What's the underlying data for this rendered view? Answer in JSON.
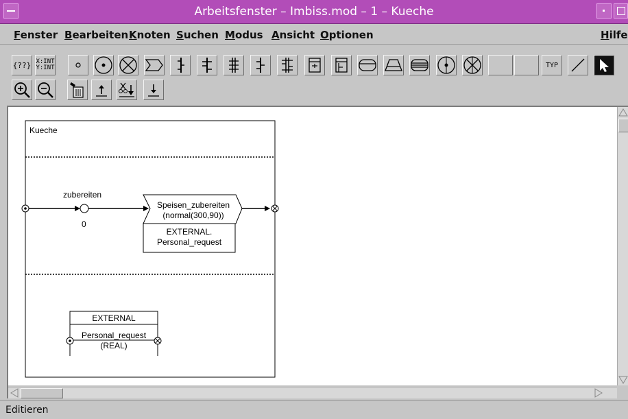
{
  "window": {
    "title": "Arbeitsfenster – Imbiss.mod – 1 – Kueche"
  },
  "menubar": {
    "items": [
      "Fenster",
      "Bearbeiten",
      "Knoten",
      "Suchen",
      "Modus",
      "Ansicht",
      "Optionen"
    ],
    "help": "Hilfe"
  },
  "toolbar": {
    "row1": [
      {
        "icon": "subnet-icon",
        "text": "{??}"
      },
      {
        "icon": "variable-type-icon",
        "text": "X:INT\nY:INT"
      },
      {
        "icon": "small-place-icon"
      },
      {
        "icon": "place-icon"
      },
      {
        "icon": "cross-place-icon"
      },
      {
        "icon": "transition-arrow-icon"
      },
      {
        "icon": "bar-1-icon"
      },
      {
        "icon": "bar-2-icon"
      },
      {
        "icon": "bar-3-icon"
      },
      {
        "icon": "bar-4-icon"
      },
      {
        "icon": "bar-5-icon"
      },
      {
        "icon": "box-in-icon"
      },
      {
        "icon": "box-out-icon"
      },
      {
        "icon": "rounded-box-icon"
      },
      {
        "icon": "trapezoid-icon"
      },
      {
        "icon": "striped-box-icon"
      },
      {
        "icon": "circle-dot-icon"
      },
      {
        "icon": "circle-x-icon"
      },
      {
        "icon": "empty-tool-1"
      },
      {
        "icon": "empty-tool-2"
      },
      {
        "icon": "type-icon",
        "text": "TYP"
      },
      {
        "icon": "line-icon"
      },
      {
        "icon": "pointer-icon"
      }
    ],
    "row2": [
      {
        "icon": "zoom-in-icon"
      },
      {
        "icon": "zoom-out-icon"
      },
      {
        "icon": "trash-icon"
      },
      {
        "icon": "upload-icon"
      },
      {
        "icon": "cut-paste-icon"
      },
      {
        "icon": "download-icon"
      }
    ]
  },
  "diagram": {
    "container_title": "Kueche",
    "place_label": "zubereiten",
    "place_tokens": "0",
    "transition_name": "Speisen_zubereiten",
    "transition_delay": "(normal(300,90))",
    "transition_ext_1": "EXTERNAL.",
    "transition_ext_2": "Personal_request",
    "external_title": "EXTERNAL",
    "external_name": "Personal_request",
    "external_type": "(REAL)"
  },
  "status": {
    "text": "Editieren"
  }
}
